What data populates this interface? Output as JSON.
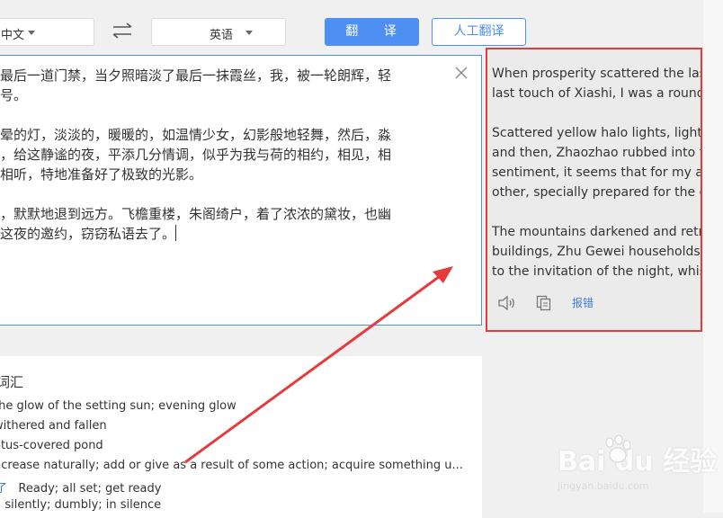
{
  "toolbar": {
    "source_lang": "中文",
    "target_lang": "英语",
    "translate_label": "翻 译",
    "human_translate_label": "人工翻译"
  },
  "source": {
    "paragraphs": [
      "了最后一道门禁，当夕照暗淡了最后一抹霞丝，我，被一轮朗辉，轻\n了号。",
      "黄晕的灯，淡淡的，暖暖的，如温情少女，幻影般地轻舞，然后，淼\n塘，给这静谧的夜，平添几分情调，似乎为我与荷的相约，相见，相\n，相听，特地准备好了极致的光影。",
      "光，默默地退到远方。飞檐重楼，朱阁绮户，着了浓浓的黛妆，也幽\n，这夜的邀约，窃窃私语去了。"
    ]
  },
  "vocab": {
    "title": "词汇",
    "rows": [
      {
        "term": "",
        "def": "the glow of the setting sun; evening glow"
      },
      {
        "term": "",
        "def": "withered and fallen"
      },
      {
        "term": "",
        "def": "otus-covered pond"
      },
      {
        "term": "",
        "def": "ncrease naturally; add or give as a result of some action; acquire something u..."
      },
      {
        "term": "了",
        "def": "Ready; all set; get ready"
      },
      {
        "term": "",
        "def": "silently; dumbly; in silence"
      }
    ]
  },
  "result": {
    "paragraphs": [
      "When prosperity scattered the last e\nlast touch of Xiashi, I was a round of l",
      "Scattered yellow halo lights, light, wa\nand then, Zhaozhao rubbed into the lo\nsentiment, it seems that for my appoi\nother, specially prepared for the extre",
      "The mountains darkened and retreate\nbuildings, Zhu Gewei households, we\nto the invitation of the night, whispere"
    ],
    "report_label": "报错"
  },
  "watermark": {
    "brand": "Bai du 经验",
    "url": "jingyan.baidu.com"
  },
  "colors": {
    "accent": "#4e8ff4",
    "annotation": "#e63b3b"
  }
}
